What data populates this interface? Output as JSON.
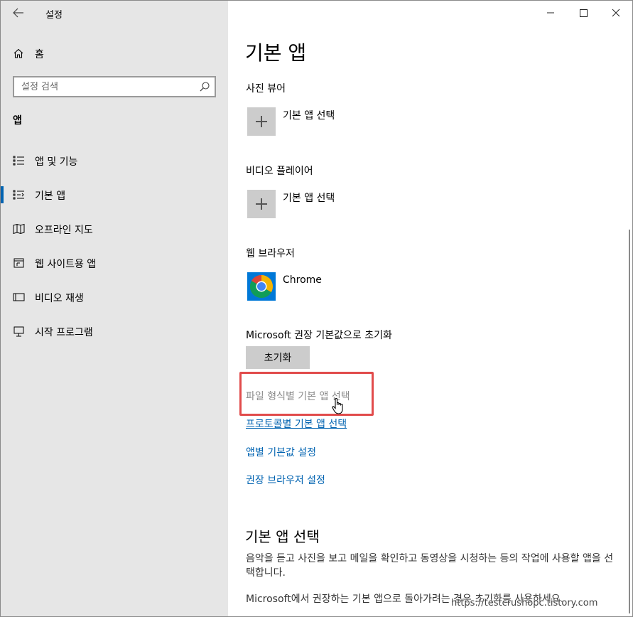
{
  "window": {
    "title": "설정"
  },
  "sidebar": {
    "home_label": "홈",
    "search": {
      "placeholder": "설정 검색",
      "value": ""
    },
    "section_label": "앱",
    "items": [
      {
        "label": "앱 및 기능",
        "icon": "apps-features-icon",
        "selected": false
      },
      {
        "label": "기본 앱",
        "icon": "default-apps-icon",
        "selected": true
      },
      {
        "label": "오프라인 지도",
        "icon": "offline-maps-icon",
        "selected": false
      },
      {
        "label": "웹 사이트용 앱",
        "icon": "apps-for-websites-icon",
        "selected": false
      },
      {
        "label": "비디오 재생",
        "icon": "video-playback-icon",
        "selected": false
      },
      {
        "label": "시작 프로그램",
        "icon": "startup-icon",
        "selected": false
      }
    ]
  },
  "main": {
    "title": "기본 앱",
    "groups": [
      {
        "label": "사진 뷰어",
        "app_label": "기본 앱 선택"
      },
      {
        "label": "비디오 플레이어",
        "app_label": "기본 앱 선택"
      },
      {
        "label": "웹 브라우저",
        "app_label": "Chrome"
      }
    ],
    "reset": {
      "label": "Microsoft 권장 기본값으로 초기화",
      "button": "초기화"
    },
    "links": [
      "파일 형식별 기본 앱 선택",
      "프로토콜별 기본 앱 선택",
      "앱별 기본값 설정",
      "권장 브라우저 설정"
    ],
    "info": {
      "title": "기본 앱 선택",
      "description": "음악을 듣고 사진을 보고 메일을 확인하고 동영상을 시청하는 등의 작업에 사용할 앱을 선택합니다.",
      "description2": "Microsoft에서 권장하는 기본 앱으로 돌아가려는 경우 초기화를 사용하세요."
    }
  },
  "watermark": "https://testcrushopc.tistory.com",
  "colors": {
    "accent": "#0063b1",
    "sidebar_bg": "#e6e6e6",
    "highlight": "#e14b4b"
  }
}
